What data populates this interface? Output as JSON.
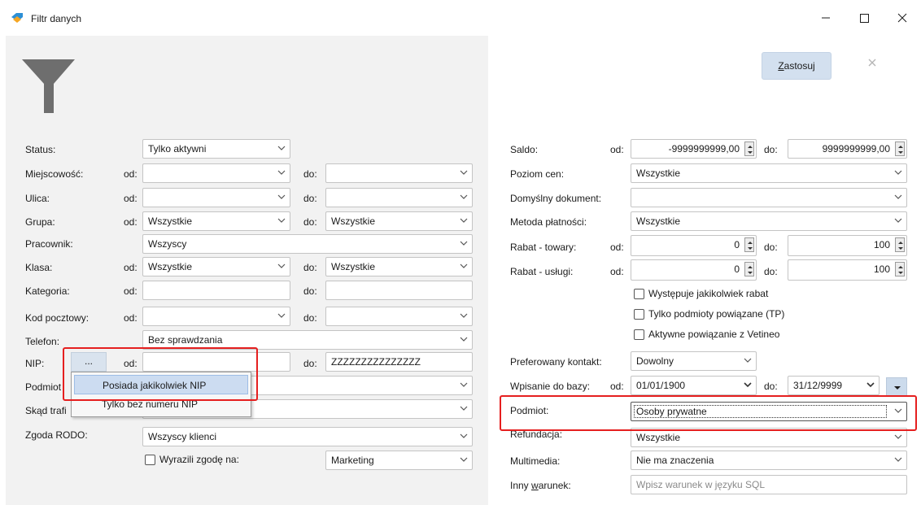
{
  "window": {
    "title": "Filtr danych",
    "icon": "tag-icon"
  },
  "toolbar": {
    "apply_prefix": "",
    "apply_hotkey": "Z",
    "apply_rest": "astosuj"
  },
  "left": {
    "status": {
      "label": "Status:",
      "value": "Tylko aktywni"
    },
    "miejscowosc": {
      "label": "Miejscowość:",
      "from_label": "od:",
      "to_label": "do:",
      "from": "",
      "to": ""
    },
    "ulica": {
      "label": "Ulica:",
      "from_label": "od:",
      "to_label": "do:",
      "from": "",
      "to": ""
    },
    "grupa": {
      "label": "Grupa:",
      "from_label": "od:",
      "to_label": "do:",
      "from": "Wszystkie",
      "to": "Wszystkie"
    },
    "pracownik": {
      "label": "Pracownik:",
      "value": "Wszyscy"
    },
    "klasa": {
      "label": "Klasa:",
      "from_label": "od:",
      "to_label": "do:",
      "from": "Wszystkie",
      "to": "Wszystkie"
    },
    "kategoria": {
      "label": "Kategoria:",
      "from_label": "od:",
      "to_label": "do:",
      "from": "",
      "to": ""
    },
    "kod_pocztowy": {
      "label": "Kod pocztowy:",
      "from_label": "od:",
      "to_label": "do:",
      "from": "",
      "to": ""
    },
    "telefon": {
      "label": "Telefon:",
      "value": "Bez sprawdzania"
    },
    "nip": {
      "label": "NIP:",
      "button": "...",
      "from_label": "od:",
      "to_label": "do:",
      "from": "",
      "to": "ZZZZZZZZZZZZZZZ"
    },
    "podmiot_partial": {
      "label": "Podmiot"
    },
    "skad_partial": {
      "label": "Skąd trafi"
    },
    "rodo": {
      "label": "Zgoda RODO:",
      "value": "Wszyscy klienci"
    },
    "zgoda": {
      "checkbox_label": "Wyrazili zgodę na:",
      "value": "Marketing"
    },
    "nip_menu": [
      "Posiada jakikolwiek NIP",
      "Tylko bez numeru NIP"
    ]
  },
  "right": {
    "saldo": {
      "label": "Saldo:",
      "from_label": "od:",
      "to_label": "do:",
      "from": "-9999999999,00",
      "to": "9999999999,00"
    },
    "poziom_cen": {
      "label": "Poziom cen:",
      "value": "Wszystkie"
    },
    "domyslny_dokument": {
      "label": "Domyślny dokument:",
      "value": ""
    },
    "metoda_platnosci": {
      "label": "Metoda płatności:",
      "value": "Wszystkie"
    },
    "rabat_towary": {
      "label": "Rabat - towary:",
      "from_label": "od:",
      "to_label": "do:",
      "from": "0",
      "to": "100"
    },
    "rabat_uslugi": {
      "label": "Rabat - usługi:",
      "from_label": "od:",
      "to_label": "do:",
      "from": "0",
      "to": "100"
    },
    "checkboxes": [
      "Występuje jakikolwiek rabat",
      "Tylko podmioty powiązane (TP)",
      "Aktywne powiązanie z Vetineo"
    ],
    "preferowany_kontakt": {
      "label": "Preferowany kontakt:",
      "value": "Dowolny"
    },
    "wpisanie": {
      "label": "Wpisanie do bazy:",
      "from_label": "od:",
      "to_label": "do:",
      "from": "01/01/1900",
      "to": "31/12/9999"
    },
    "podmiot": {
      "label": "Podmiot:",
      "value": "Osoby prywatne"
    },
    "refundacja": {
      "label": "Refundacja:",
      "value": "Wszystkie"
    },
    "multimedia": {
      "label": "Multimedia:",
      "value": "Nie ma znaczenia"
    },
    "inny_warunek": {
      "label_prefix": "Inny ",
      "label_hotkey": "w",
      "label_rest": "arunek:",
      "placeholder": "Wpisz warunek w języku SQL"
    }
  },
  "colors": {
    "highlight_red": "#e51f1f",
    "apply_button_bg": "#d3e0ef",
    "left_pane_bg": "#f2f2f2"
  }
}
